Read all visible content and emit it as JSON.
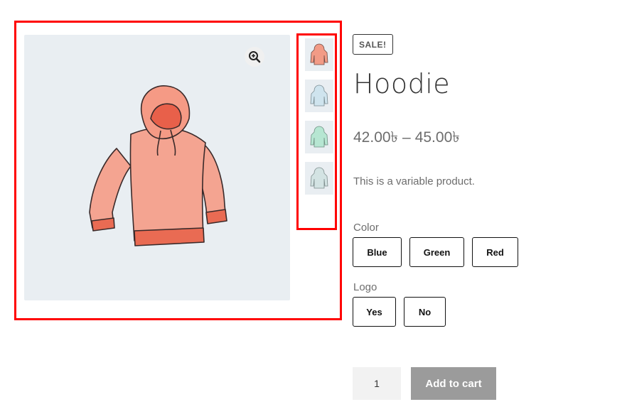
{
  "product": {
    "sale_badge": "SALE!",
    "title": "Hoodie",
    "price_min": "42.00৳",
    "price_sep": "–",
    "price_max": "45.00৳",
    "description": "This is a variable product."
  },
  "gallery": {
    "zoom_icon": "zoom-in-icon",
    "main_image_color": "#f29b86",
    "thumbnails": [
      {
        "name": "hoodie-red",
        "color": "#f29b86"
      },
      {
        "name": "hoodie-blue",
        "color": "#cfe4ee"
      },
      {
        "name": "hoodie-green",
        "color": "#b6e6d2"
      },
      {
        "name": "hoodie-gray",
        "color": "#d3e3e3"
      }
    ]
  },
  "attributes": {
    "color": {
      "label": "Color",
      "options": [
        "Blue",
        "Green",
        "Red"
      ]
    },
    "logo": {
      "label": "Logo",
      "options": [
        "Yes",
        "No"
      ]
    }
  },
  "cart": {
    "quantity": "1",
    "add_to_cart_label": "Add to cart"
  },
  "colors": {
    "highlight_border": "#ff0000",
    "button_disabled": "#9b9b9b"
  }
}
